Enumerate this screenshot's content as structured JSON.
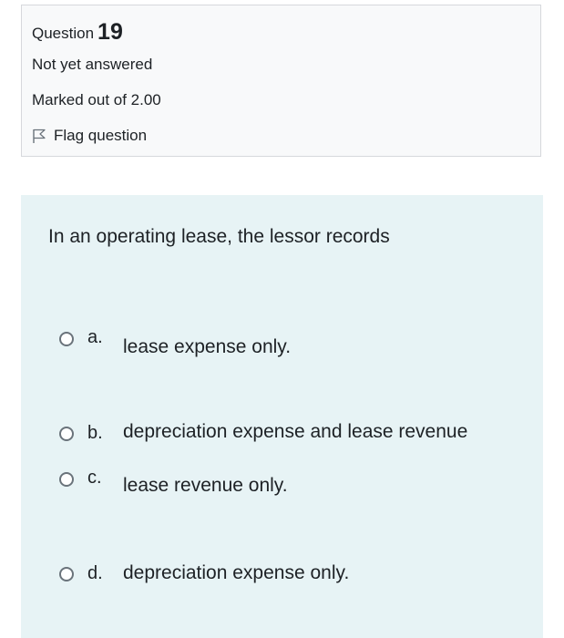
{
  "info": {
    "question_label": "Question",
    "question_number": "19",
    "state": "Not yet answered",
    "grade": "Marked out of 2.00",
    "flag_label": "Flag question"
  },
  "question": {
    "text": "In an operating lease, the lessor records",
    "options": [
      {
        "letter": "a.",
        "text": "lease expense only.",
        "selected": false
      },
      {
        "letter": "b.",
        "text": "depreciation expense and lease revenue",
        "selected": false
      },
      {
        "letter": "c.",
        "text": "lease revenue only.",
        "selected": false
      },
      {
        "letter": "d.",
        "text": "depreciation expense only.",
        "selected": false
      }
    ]
  },
  "colors": {
    "info_background": "#f8f9fa",
    "content_background": "#e7f3f5",
    "radio_border": "#6a737b"
  }
}
